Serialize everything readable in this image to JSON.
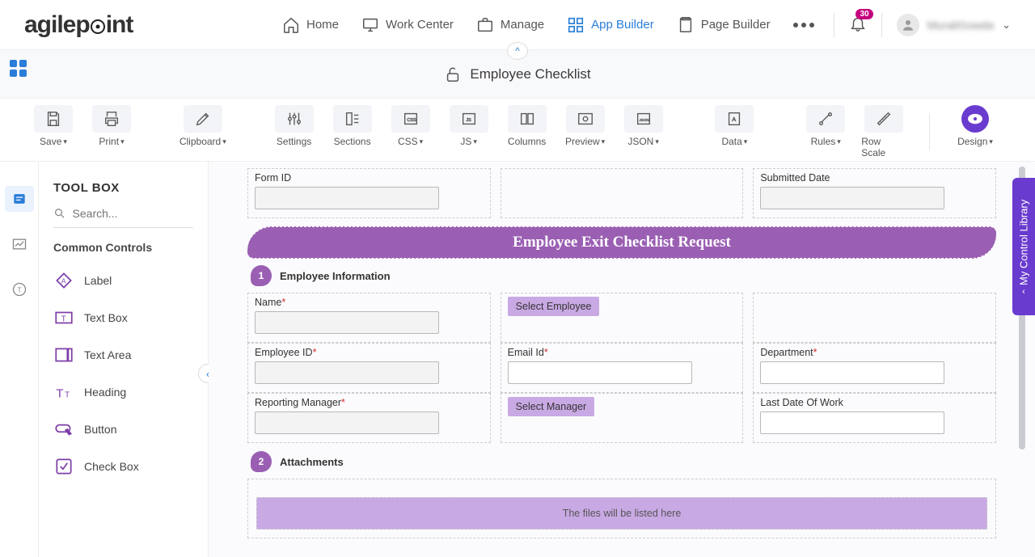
{
  "nav": {
    "home": "Home",
    "workcenter": "Work Center",
    "manage": "Manage",
    "appbuilder": "App Builder",
    "pagebuilder": "Page Builder",
    "badge": "30",
    "username": "MuraliGowda"
  },
  "crumb": {
    "title": "Employee Checklist"
  },
  "toolbar": {
    "save": "Save",
    "print": "Print",
    "clipboard": "Clipboard",
    "settings": "Settings",
    "sections": "Sections",
    "css": "CSS",
    "js": "JS",
    "columns": "Columns",
    "preview": "Preview",
    "json": "JSON",
    "data": "Data",
    "rules": "Rules",
    "rowscale": "Row Scale",
    "design": "Design"
  },
  "toolbox": {
    "title": "TOOL BOX",
    "search_placeholder": "Search...",
    "common": "Common Controls",
    "items": [
      "Label",
      "Text Box",
      "Text Area",
      "Heading",
      "Button",
      "Check Box"
    ]
  },
  "form": {
    "formid": "Form ID",
    "submitted": "Submitted Date",
    "banner": "Employee Exit Checklist Request",
    "sec1": {
      "num": "1",
      "title": "Employee Information"
    },
    "name": "Name",
    "selemp": "Select Employee",
    "empid": "Employee ID",
    "email": "Email Id",
    "dept": "Department",
    "repmgr": "Reporting Manager",
    "selmgr": "Select Manager",
    "lastdate": "Last Date Of Work",
    "sec2": {
      "num": "2",
      "title": "Attachments"
    },
    "filesmsg": "The files will be listed here"
  },
  "right_tab": "My Control Library"
}
